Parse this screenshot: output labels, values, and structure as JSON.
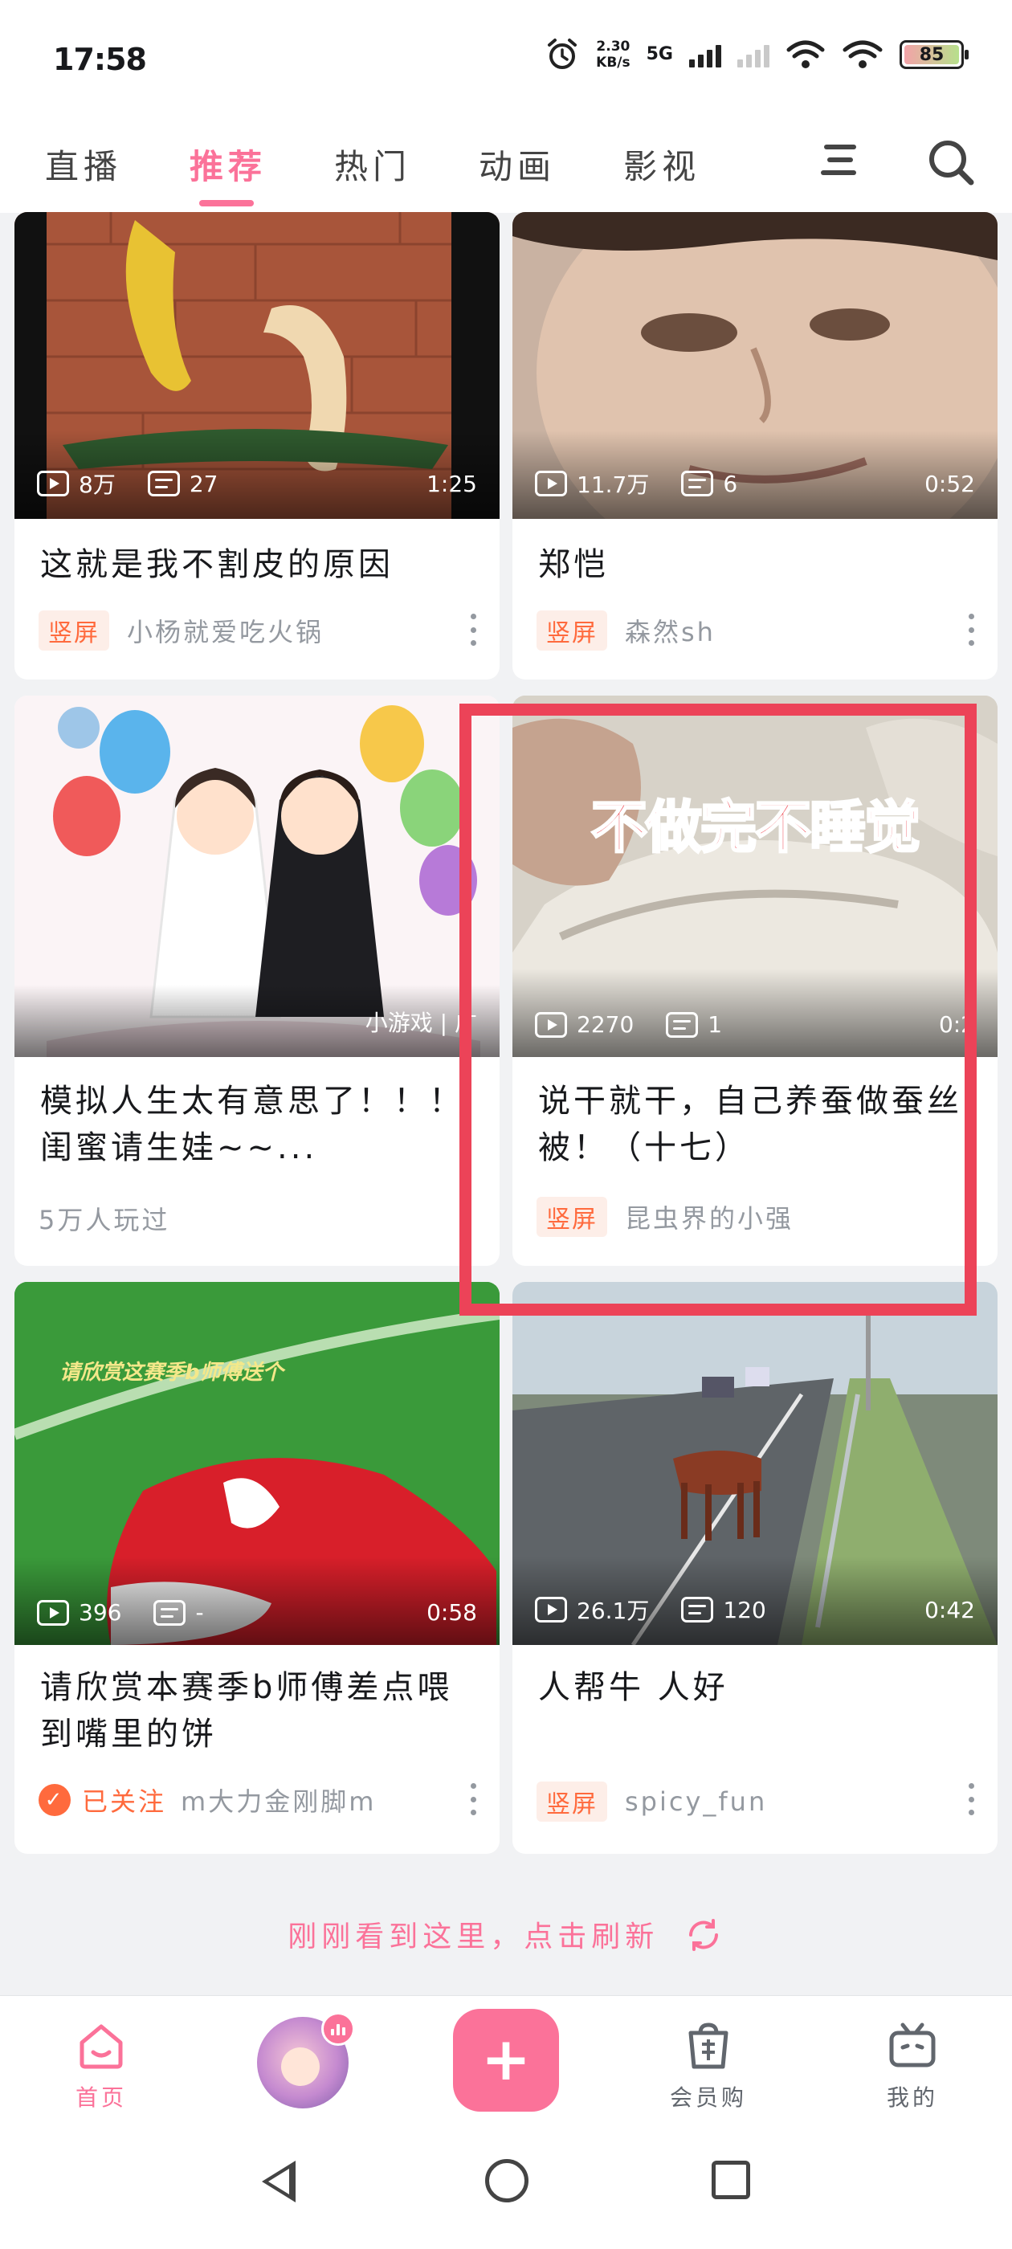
{
  "status_bar": {
    "time": "17:58",
    "net_speed_value": "2.30",
    "net_speed_unit": "KB/s",
    "network": "5G",
    "battery": "85"
  },
  "top_tabs": [
    "直播",
    "推荐",
    "热门",
    "动画",
    "影视"
  ],
  "active_tab": "推荐",
  "feed": [
    {
      "views": "8万",
      "danmaku": "27",
      "duration": "1:25",
      "title": "这就是我不割皮的原因",
      "badge": "竖屏",
      "author": "小杨就爱吃火锅"
    },
    {
      "views": "11.7万",
      "danmaku": "6",
      "duration": "0:52",
      "title": "郑恺",
      "badge": "竖屏",
      "author": "森然sh"
    },
    {
      "overlay_text": "小游戏 | 广",
      "title": "模拟人生太有意思了！！！闺蜜请生娃~~...",
      "sub": "5万人玩过"
    },
    {
      "caption": "不做完不睡觉",
      "views": "2270",
      "danmaku": "1",
      "duration": "0:2",
      "title": "说干就干，自己养蚕做蚕丝被！（十七）",
      "badge": "竖屏",
      "author": "昆虫界的小强"
    },
    {
      "caption": "请欣赏这赛季b师傅送个",
      "views": "396",
      "danmaku": "-",
      "duration": "0:58",
      "title": "请欣赏本赛季b师傅差点喂到嘴里的饼",
      "followed_label": "已关注",
      "author": "m大力金刚脚m"
    },
    {
      "views": "26.1万",
      "danmaku": "120",
      "duration": "0:42",
      "title": "人帮牛 人好",
      "badge": "竖屏",
      "author": "spicy_fun"
    }
  ],
  "refresh_text": "刚刚看到这里，点击刷新",
  "bottom_nav": {
    "home": "首页",
    "shop": "会员购",
    "mine": "我的"
  },
  "colors": {
    "accent": "#fb7299",
    "badge_text": "#ff6a3d",
    "highlight_box": "#ec4358"
  }
}
